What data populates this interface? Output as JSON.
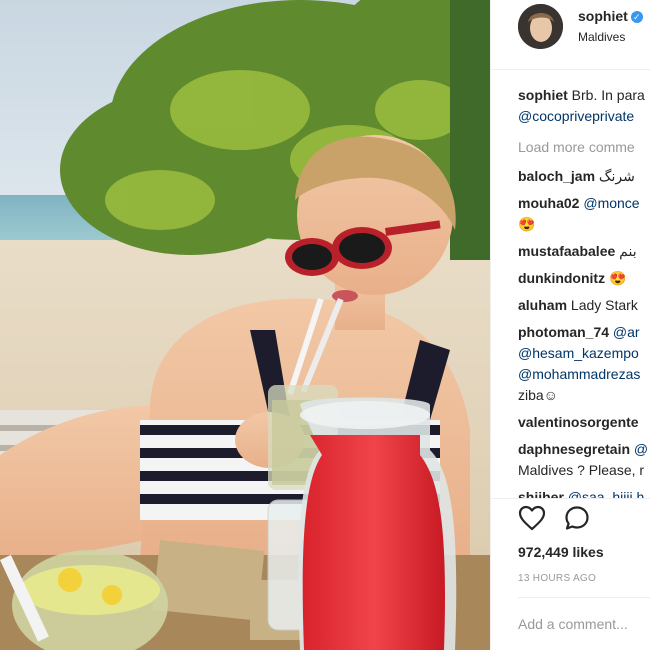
{
  "post": {
    "username": "sophiet",
    "location": "Maldives",
    "caption_user": "sophiet",
    "caption_text": "Brb. In para",
    "caption_mention": "@cocopriveprivate",
    "load_more": "Load more comme",
    "comments": [
      {
        "user": "baloch_jam",
        "text": "شرنگ"
      },
      {
        "user": "mouha02",
        "mention": "@monce",
        "text2": "😍"
      },
      {
        "user": "mustafaabalee",
        "text": "بنم"
      },
      {
        "user": "dunkindonitz",
        "text": "😍"
      },
      {
        "user": "aluham",
        "text": "Lady Stark"
      },
      {
        "user": "photoman_74",
        "mention": "@ar",
        "mention2": "@hesam_kazempo",
        "mention3": "@mohammadrezas",
        "text2": "ziba☺"
      },
      {
        "user": "valentinosorgente",
        "text": ""
      },
      {
        "user": "daphnesegretain",
        "text": "@",
        "text2": "Maldives ? Please, r"
      },
      {
        "user": "shiiher",
        "mention": "@saa_hiiii h"
      }
    ],
    "likes": "972,449 likes",
    "timestamp": "13 HOURS AGO",
    "add_comment_placeholder": "Add a comment..."
  },
  "icons": {
    "verified": "verified-badge-icon",
    "like": "heart-outline-icon",
    "comment": "comment-bubble-icon"
  },
  "colors": {
    "verified": "#3897f0",
    "text": "#262626",
    "muted": "#999999",
    "mention": "#003569"
  }
}
